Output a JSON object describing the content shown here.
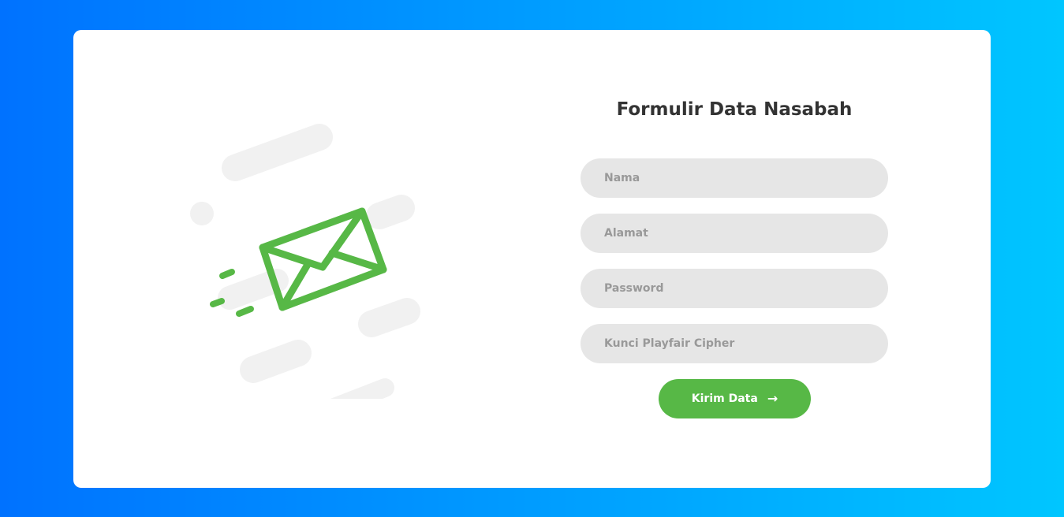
{
  "form": {
    "title": "Formulir Data Nasabah",
    "fields": {
      "nama": {
        "placeholder": "Nama"
      },
      "alamat": {
        "placeholder": "Alamat"
      },
      "password": {
        "placeholder": "Password"
      },
      "kunci": {
        "placeholder": "Kunci Playfair Cipher"
      }
    },
    "submit_label": "Kirim Data",
    "submit_icon": "→"
  },
  "illustration": {
    "icon": "envelope-flying-icon"
  },
  "colors": {
    "background_gradient_start": "#0072ff",
    "background_gradient_end": "#00c6ff",
    "card": "#ffffff",
    "accent_green": "#57b846",
    "input_background": "#e6e6e6",
    "title_text": "#333333",
    "placeholder_text": "#999999"
  }
}
